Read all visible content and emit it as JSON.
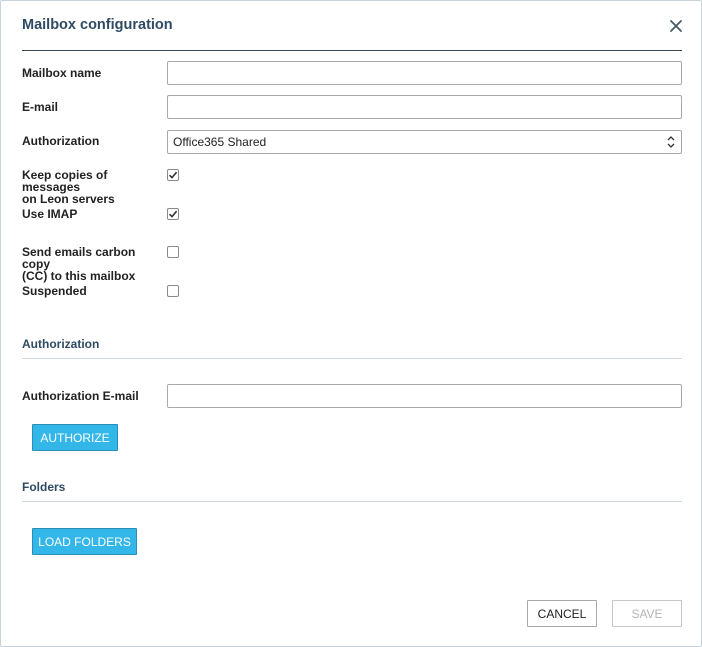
{
  "dialog": {
    "title": "Mailbox configuration",
    "close_icon": "close-icon"
  },
  "form": {
    "mailbox_name": {
      "label": "Mailbox name",
      "value": ""
    },
    "email": {
      "label": "E-mail",
      "value": ""
    },
    "authorization": {
      "label": "Authorization",
      "selected": "Office365 Shared"
    },
    "keep_copies": {
      "label_line1": "Keep copies of messages",
      "label_line2": "on Leon servers",
      "checked": true
    },
    "use_imap": {
      "label": "Use IMAP",
      "checked": true
    },
    "send_cc": {
      "label_line1": "Send emails carbon copy",
      "label_line2": "(CC) to this mailbox",
      "checked": false
    },
    "suspended": {
      "label": "Suspended",
      "checked": false
    }
  },
  "authorization_section": {
    "title": "Authorization",
    "email_label": "Authorization E-mail",
    "email_value": "",
    "authorize_button": "AUTHORIZE"
  },
  "folders_section": {
    "title": "Folders",
    "load_button": "LOAD FOLDERS"
  },
  "footer": {
    "cancel": "CANCEL",
    "save": "SAVE"
  },
  "colors": {
    "accent": "#33b7e8",
    "heading": "#2f4a63"
  }
}
